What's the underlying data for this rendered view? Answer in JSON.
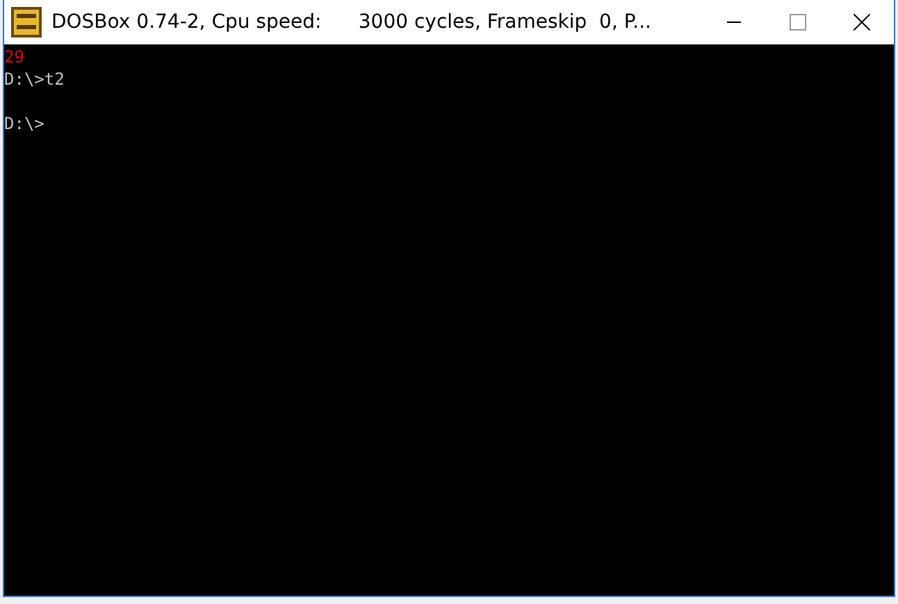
{
  "window": {
    "title": "DOSBox 0.74-2, Cpu speed:      3000 cycles, Frameskip  0, P..."
  },
  "console": {
    "lines": [
      {
        "text": "29",
        "kind": "error"
      },
      {
        "text": "D:\\>t2",
        "kind": "command"
      },
      {
        "text": "D:\\>",
        "kind": "prompt"
      }
    ]
  }
}
